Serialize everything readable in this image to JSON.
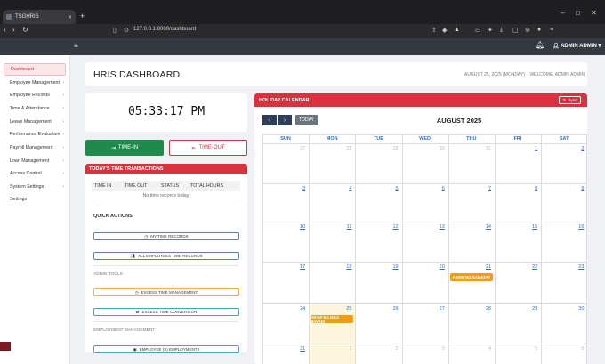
{
  "browser": {
    "tab_title": "TSGHRIS",
    "new_tab": "+",
    "url": "127.0.0.1:8000/dashboard",
    "window_controls": [
      "–",
      "□",
      "✕"
    ]
  },
  "navbar": {
    "menu_icon": "menu-icon",
    "bell_icon": "bell-icon",
    "user_label": "ADMIN ADMIN ▾"
  },
  "sidebar": {
    "items": [
      {
        "label": "Dashboard",
        "active": true,
        "chev": ""
      },
      {
        "label": "Employee Management",
        "active": false,
        "chev": "›"
      },
      {
        "label": "Employee Records",
        "active": false,
        "chev": "›"
      },
      {
        "label": "Time & Attendance",
        "active": false,
        "chev": "›"
      },
      {
        "label": "Leave Management",
        "active": false,
        "chev": "›"
      },
      {
        "label": "Performance Evaluation",
        "active": false,
        "chev": "›"
      },
      {
        "label": "Payroll Management",
        "active": false,
        "chev": "›"
      },
      {
        "label": "Loan Management",
        "active": false,
        "chev": "›"
      },
      {
        "label": "Access Control",
        "active": false,
        "chev": "›"
      },
      {
        "label": "System Settings",
        "active": false,
        "chev": "›"
      },
      {
        "label": "Settings",
        "active": false,
        "chev": ""
      }
    ]
  },
  "header": {
    "title": "HRIS DASHBOARD",
    "date": "AUGUST 25, 2025 (MONDAY)",
    "welcome": "WELCOME, ADMIN ADMIN"
  },
  "clock": {
    "time": "05:33:17 PM",
    "time_in_label": "TIME-IN",
    "time_out_label": "TIME-OUT"
  },
  "transactions": {
    "title": "TODAY'S TIME TRANSACTIONS",
    "columns": [
      "TIME IN",
      "TIME OUT",
      "STATUS",
      "TOTAL HOURS"
    ],
    "empty_text": "No time records today"
  },
  "quick_actions": {
    "title": "QUICK ACTIONS",
    "my_records": "MY TIME RECORDS",
    "all_records": "ALL EMPLOYEES TIME RECORDS",
    "admin_tools_label": "ADMIN TOOLS",
    "excess_mgmt": "EXCESS TIME MANAGEMENT",
    "excess_conv": "EXCESS TIME CONVERSION",
    "emp_mgmt_label": "EMPLOYMENT MANAGEMENT",
    "employee_employments": "EMPLOYEE (S) EMPLOYMENTS"
  },
  "calendar": {
    "title": "HOLIDAY CALENDAR",
    "sync_label": "Sync",
    "today_label": "TODAY",
    "prev": "‹",
    "next": "›",
    "month": "AUGUST 2025",
    "weekdays": [
      "SUN",
      "MON",
      "TUE",
      "WED",
      "THU",
      "FRI",
      "SAT"
    ],
    "weeks": [
      [
        "27",
        "28",
        "29",
        "30",
        "31",
        "1",
        "2"
      ],
      [
        "3",
        "4",
        "5",
        "6",
        "7",
        "8",
        "9"
      ],
      [
        "10",
        "11",
        "12",
        "13",
        "14",
        "15",
        "16"
      ],
      [
        "17",
        "18",
        "19",
        "20",
        "21",
        "22",
        "23"
      ],
      [
        "24",
        "25",
        "26",
        "27",
        "28",
        "29",
        "30"
      ],
      [
        "31",
        "1",
        "2",
        "3",
        "4",
        "5",
        "6"
      ]
    ],
    "events": [
      {
        "label": "ARAW NG KAMATAY",
        "date": "21"
      },
      {
        "label": "ARAW NG MGA BAYANI",
        "date": "25"
      }
    ],
    "event_color": "#f39c12",
    "accent": "#d8323f"
  }
}
